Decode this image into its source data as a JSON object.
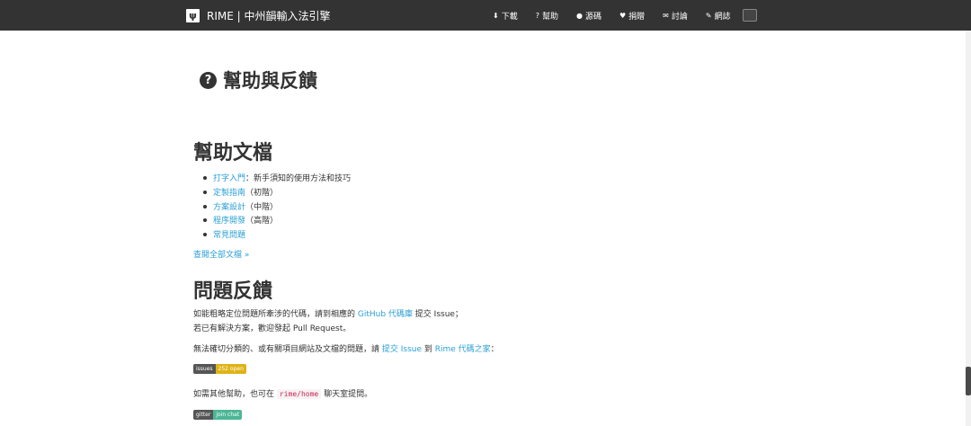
{
  "navbar": {
    "logo": "ψ",
    "brand": "RIME | 中州韻輸入法引擎",
    "items": [
      {
        "icon": "⬇",
        "label": "下載"
      },
      {
        "icon": "?",
        "label": "幫助"
      },
      {
        "icon": "●",
        "label": "源碼"
      },
      {
        "icon": "♥",
        "label": "捐贈"
      },
      {
        "icon": "✉",
        "label": "討論"
      },
      {
        "icon": "✎",
        "label": "網誌"
      }
    ]
  },
  "header": {
    "icon": "?",
    "title": "幫助與反饋"
  },
  "docs": {
    "heading": "幫助文檔",
    "items": [
      {
        "link": "打字入門",
        "note": "：新手須知的使用方法和技巧"
      },
      {
        "link": "定製指南",
        "note": "（初階）"
      },
      {
        "link": "方案設計",
        "note": "（中階）"
      },
      {
        "link": "程序開發",
        "note": "（高階）"
      },
      {
        "link": "常見問題",
        "note": ""
      }
    ],
    "all_link": "查閱全部文檔 »"
  },
  "feedback": {
    "heading": "問題反饋",
    "p1_a": "如能粗略定位問題所牽涉的代碼，請到相應的 ",
    "p1_link": "GitHub 代碼庫",
    "p1_b": " 提交 Issue；",
    "p1_line2": "若已有解決方案，歡迎發起 Pull Request。",
    "p2_a": "無法確切分類的、或有關項目網站及文檔的問題，請 ",
    "p2_link1": "提交 Issue",
    "p2_b": " 到 ",
    "p2_link2": "Rime 代碼之家",
    "p2_c": "：",
    "badge_issues": {
      "left": "issues",
      "right": "252 open"
    },
    "p3_a": "如需其他幫助，也可在 ",
    "p3_code": "rime/home",
    "p3_b": " 聊天室提問。",
    "badge_gitter": {
      "left": "gitter",
      "right": "join chat"
    }
  }
}
